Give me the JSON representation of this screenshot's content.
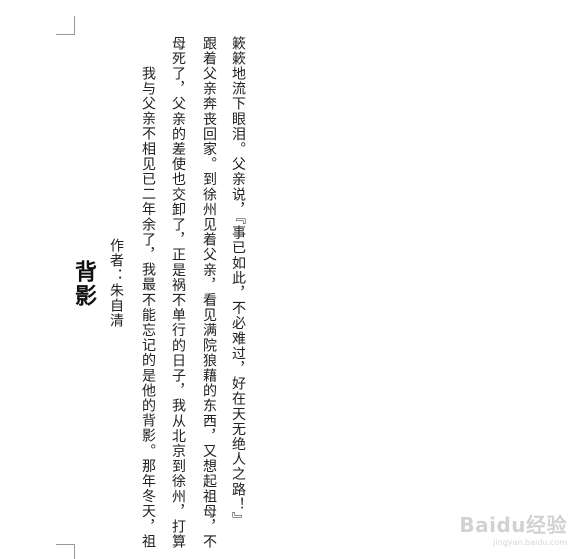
{
  "document": {
    "title": "背影",
    "author": "作者：朱自清",
    "columns": [
      "簌簌地流下眼泪。父亲说，『事已如此，不必难过，好在天无绝人之路！』",
      "跟着父亲奔丧回家。到徐州见着父亲，看见满院狼藉的东西，又想起祖母，不",
      "母死了，父亲的差使也交卸了，正是祸不单行的日子，我从北京到徐州，打算",
      "我与父亲不相见已二年余了，我最不能忘记的是他的背影。那年冬天，祖"
    ]
  },
  "watermark": {
    "brand": "Baidu经验",
    "sub": "jingyan.baidu.com"
  }
}
